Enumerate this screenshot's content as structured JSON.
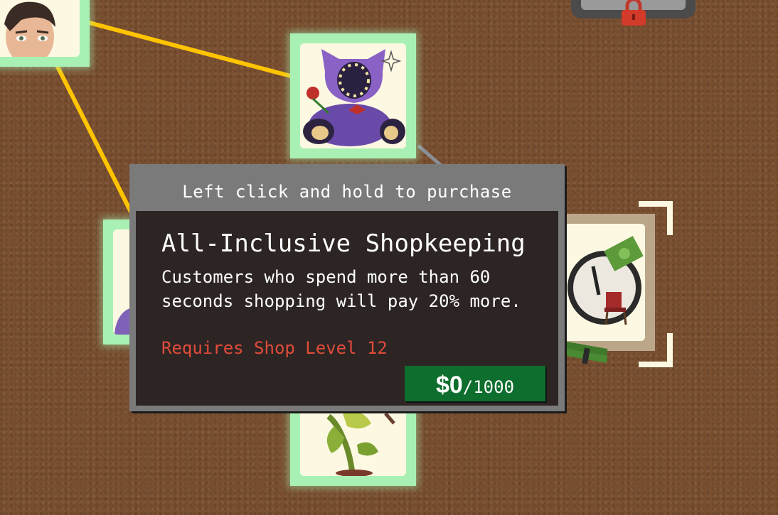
{
  "tooltip": {
    "hint": "Left click and hold to purchase",
    "title": "All-Inclusive Shopkeeping",
    "description": "Customers who spend more than 60\nseconds shopping will pay 20% more.",
    "requirement": "Requires Shop Level 12",
    "price": {
      "current": "$0",
      "separator": "/",
      "cost": "1000"
    }
  },
  "colors": {
    "background": "#7a4f30",
    "node_border_unlocked": "#a9f0b4",
    "node_border_tan": "#bba68a",
    "link_active": "#ffc400",
    "link_inactive": "#8a8f96",
    "requirement_text": "#e24b3b",
    "price_button": "#0d6e2d"
  },
  "nodes": [
    {
      "icon": "man-face-icon"
    },
    {
      "icon": "purple-plush-toy-icon"
    },
    {
      "icon": "clock-money-chair-icon"
    },
    {
      "icon": "venus-flytrap-plant-icon"
    },
    {
      "icon": "purple-partial-icon"
    },
    {
      "icon": "lock-icon"
    }
  ]
}
